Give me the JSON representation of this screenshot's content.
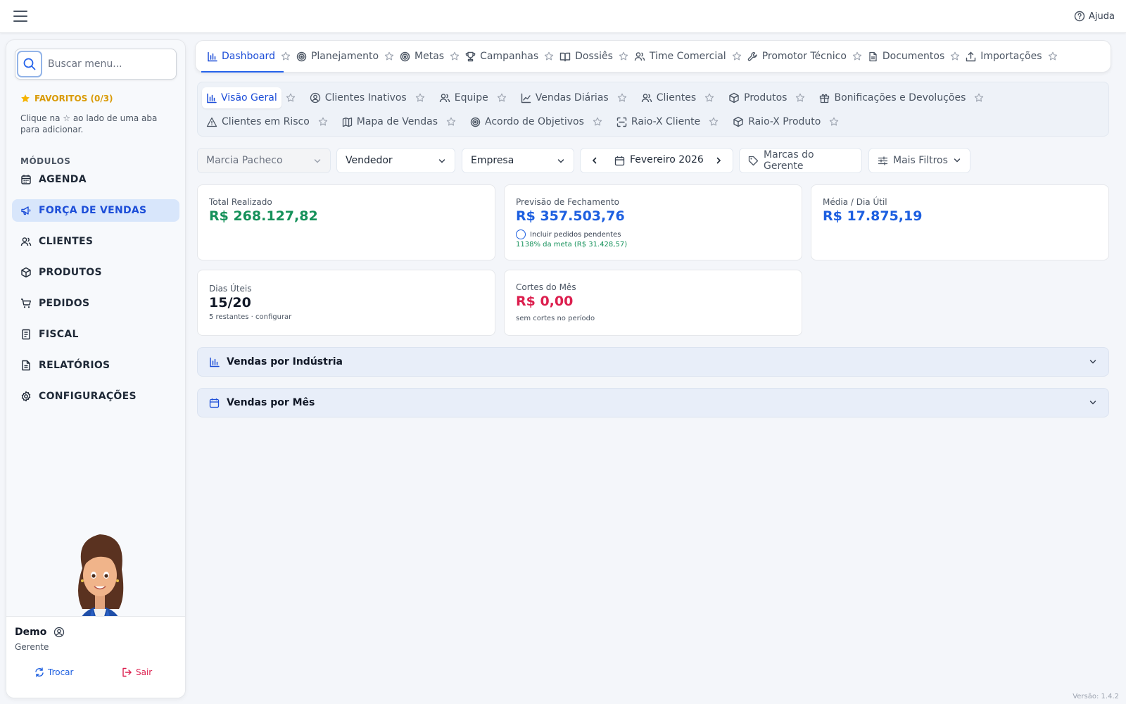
{
  "topbar": {
    "help_label": "Ajuda"
  },
  "sidebar": {
    "search_placeholder": "Buscar menu...",
    "favorites_title": "FAVORITOS (0/3)",
    "favorites_hint": "Clique na ☆ ao lado de uma aba para adicionar.",
    "modules_title": "MÓDULOS",
    "items": [
      {
        "label": "AGENDA",
        "icon": "calendar-icon"
      },
      {
        "label": "FORÇA DE VENDAS",
        "icon": "megaphone-icon",
        "active": true
      },
      {
        "label": "CLIENTES",
        "icon": "users-icon"
      },
      {
        "label": "PRODUTOS",
        "icon": "box-icon"
      },
      {
        "label": "PEDIDOS",
        "icon": "cart-icon"
      },
      {
        "label": "FISCAL",
        "icon": "receipt-icon"
      },
      {
        "label": "RELATÓRIOS",
        "icon": "report-icon"
      },
      {
        "label": "CONFIGURAÇÕES",
        "icon": "gear-icon"
      }
    ],
    "user": {
      "name": "Demo",
      "role": "Gerente",
      "switch_label": "Trocar",
      "logout_label": "Sair"
    }
  },
  "main_tabs": [
    {
      "label": "Dashboard",
      "icon": "bar-chart-icon",
      "active": true
    },
    {
      "label": "Planejamento",
      "icon": "target-icon"
    },
    {
      "label": "Metas",
      "icon": "target-icon"
    },
    {
      "label": "Campanhas",
      "icon": "trophy-icon"
    },
    {
      "label": "Dossiês",
      "icon": "book-icon"
    },
    {
      "label": "Time Comercial",
      "icon": "users-icon"
    },
    {
      "label": "Promotor Técnico",
      "icon": "wrench-icon"
    },
    {
      "label": "Documentos",
      "icon": "document-icon"
    },
    {
      "label": "Importações",
      "icon": "upload-icon"
    }
  ],
  "sub_tabs_row1": [
    {
      "label": "Visão Geral",
      "icon": "bar-chart-icon",
      "active": true
    },
    {
      "label": "Clientes Inativos",
      "icon": "user-circle-icon"
    },
    {
      "label": "Equipe",
      "icon": "users-icon"
    },
    {
      "label": "Vendas Diárias",
      "icon": "line-chart-icon"
    },
    {
      "label": "Clientes",
      "icon": "users-icon"
    },
    {
      "label": "Produtos",
      "icon": "box-icon"
    },
    {
      "label": "Bonificações e Devoluções",
      "icon": "gift-icon"
    }
  ],
  "sub_tabs_row2": [
    {
      "label": "Clientes em Risco",
      "icon": "warning-icon"
    },
    {
      "label": "Mapa de Vendas",
      "icon": "map-icon"
    },
    {
      "label": "Acordo de Objetivos",
      "icon": "target-icon"
    },
    {
      "label": "Raio-X Cliente",
      "icon": "scan-icon"
    },
    {
      "label": "Raio-X Produto",
      "icon": "box-icon"
    }
  ],
  "filters": {
    "manager": "Marcia Pacheco",
    "seller": "Vendedor",
    "company": "Empresa",
    "period": "Fevereiro 2026",
    "brands": "Marcas do Gerente",
    "more": "Mais Filtros"
  },
  "cards": {
    "total": {
      "label": "Total Realizado",
      "value": "R$ 268.127,82",
      "color": "#15915a"
    },
    "forecast": {
      "label": "Previsão de Fechamento",
      "value": "R$ 357.503,76",
      "pending_label": "Incluir pedidos pendentes",
      "meta_text": "1138% da meta (R$ 31.428,57)",
      "color": "#1d5fe0"
    },
    "avg": {
      "label": "Média / Dia Útil",
      "value": "R$ 17.875,19",
      "color": "#1d5fe0"
    },
    "days": {
      "label": "Dias Úteis",
      "value": "15/20",
      "sub": "5 restantes · configurar"
    },
    "cuts": {
      "label": "Cortes do Mês",
      "value": "R$ 0,00",
      "sub": "sem cortes no período",
      "color": "#dc1f4e"
    }
  },
  "accordions": {
    "industry": "Vendas por Indústria",
    "month": "Vendas por Mês"
  },
  "version": "Versão: 1.4.2"
}
